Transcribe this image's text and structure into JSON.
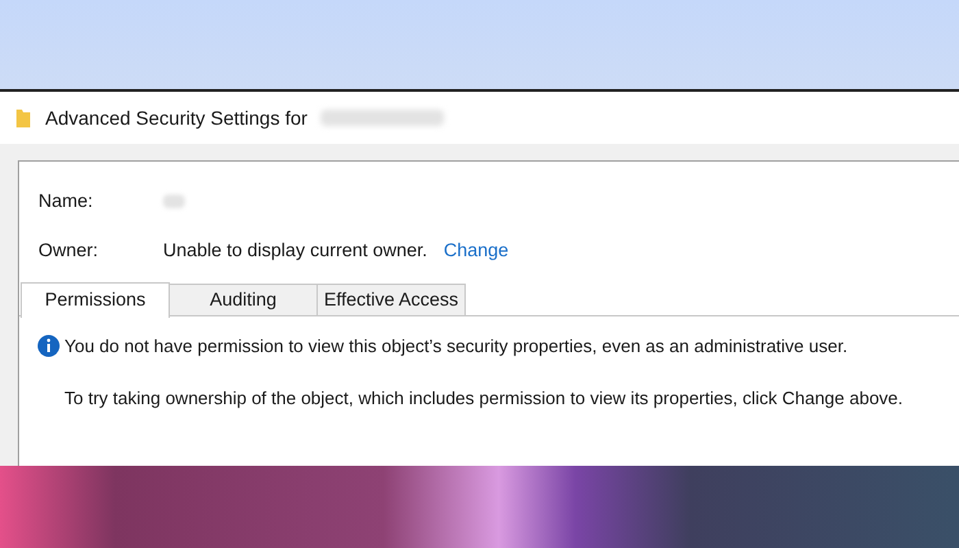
{
  "window": {
    "title": "Advanced Security Settings for"
  },
  "fields": [
    {
      "label": "Name:",
      "kind": "redacted"
    },
    {
      "label": "Owner:",
      "kind": "text",
      "value": "Unable to display current owner.",
      "link": "Change"
    }
  ],
  "tabs": [
    {
      "label": "Permissions",
      "selected": true
    },
    {
      "label": "Auditing",
      "selected": false
    },
    {
      "label": "Effective Access",
      "selected": false
    }
  ],
  "message": {
    "warning": "You do not have permission to view this object’s security properties, even as an administrative user.",
    "hint": "To try taking ownership of the object, which includes permission to view its properties, click Change above."
  }
}
